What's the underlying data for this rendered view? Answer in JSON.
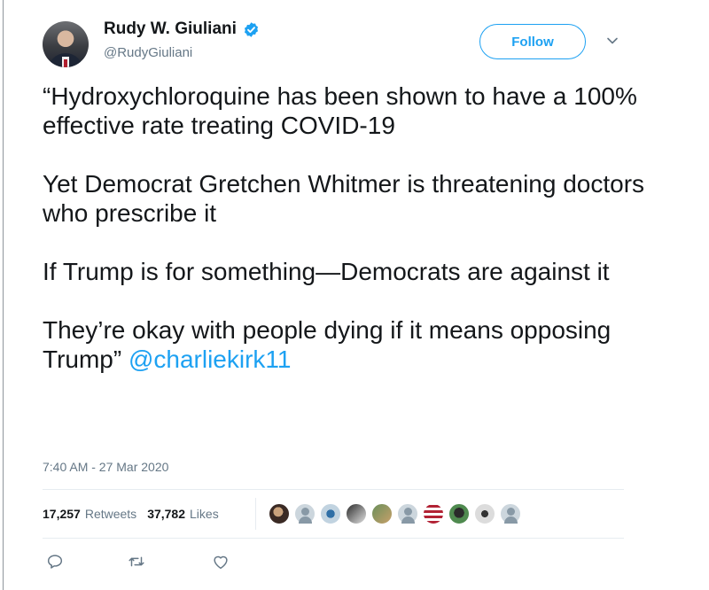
{
  "tweet": {
    "author": {
      "display_name": "Rudy W. Giuliani",
      "handle": "@RudyGiuliani",
      "verified": true
    },
    "follow_label": "Follow",
    "paragraphs": [
      "“Hydroxychloroquine has been shown to have a 100% effective rate treating COVID-19",
      "Yet Democrat Gretchen Whitmer is threatening doctors who prescribe it",
      "If Trump is for something—Democrats are against it",
      "They’re okay with people dying if it means opposing Trump”"
    ],
    "mention": "@charliekirk11",
    "timestamp": "7:40 AM - 27 Mar 2020",
    "stats": {
      "retweets_count": "17,257",
      "retweets_label": "Retweets",
      "likes_count": "37,782",
      "likes_label": "Likes"
    },
    "liker_avatars": [
      "photo",
      "default",
      "photo",
      "photo",
      "photo",
      "default",
      "photo",
      "photo",
      "photo",
      "default"
    ],
    "actions": [
      "reply-icon",
      "retweet-icon",
      "like-icon"
    ]
  },
  "colors": {
    "accent": "#1da1f2",
    "text": "#14171a",
    "secondary_text": "#657786",
    "divider": "#e6ecf0"
  }
}
